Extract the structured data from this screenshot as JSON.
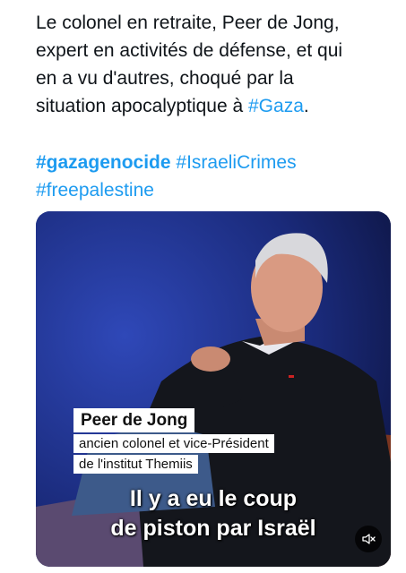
{
  "tweet": {
    "text_lines": [
      "Le colonel en retraite, Peer de Jong,",
      "expert en activités de défense, et qui",
      "en a vu d'autres, choqué par la",
      "situation apocalyptique à "
    ],
    "inline_hashtag": "#Gaza",
    "trailing_punct": ".",
    "hashtags": [
      "#gazagenocide",
      "#IsraeliCrimes",
      "#freepalestine"
    ],
    "link_color": "#1d9bf0"
  },
  "media": {
    "caption_name": "Peer de Jong",
    "caption_role_1": "ancien colonel et vice-Président",
    "caption_role_2": "de l'institut Themiis",
    "subtitle_1": "Il y a eu le coup",
    "subtitle_2": "de piston par Israël",
    "mute_icon": "volume-muted-icon"
  }
}
